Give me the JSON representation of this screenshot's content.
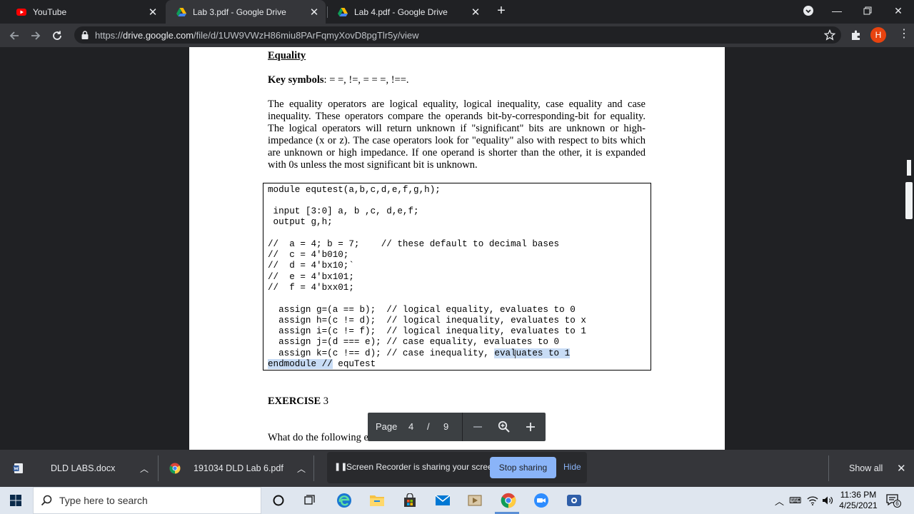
{
  "tabs": [
    {
      "title": "YouTube",
      "active": false,
      "icon": "youtube-icon"
    },
    {
      "title": "Lab 3.pdf - Google Drive",
      "active": true,
      "icon": "google-drive-icon"
    },
    {
      "title": "Lab 4.pdf - Google Drive",
      "active": false,
      "icon": "google-drive-icon"
    }
  ],
  "address": {
    "scheme": "https://",
    "host": "drive.google.com",
    "path": "/file/d/1UW9VWzH86miu8PArFqmyXovD8pgTlr5y/view"
  },
  "profile_initial": "H",
  "document": {
    "heading": "Equality",
    "key_symbols_label": "Key symbols",
    "key_symbols": ": = =, !=, = = =, !==.",
    "para_lines": [
      "The equality operators are logical equality, logical inequality, case equality and case",
      "inequality. These operators compare the operands bit-by-corresponding-bit for equality.",
      "The logical operators will return unknown if \"significant\" bits are unknown or high-",
      "impedance (x or z). The case operators look for \"equality\" also with respect to bits which",
      "are unknown or high impedance. If one operand is shorter than the other, it is expanded",
      "with 0s unless the most significant bit is unknown."
    ],
    "code_lines": [
      "module equtest(a,b,c,d,e,f,g,h);",
      "",
      " input [3:0] a, b ,c, d,e,f;",
      " output g,h;",
      "",
      "//  a = 4; b = 7;    // these default to decimal bases",
      "//  c = 4'b010;",
      "//  d = 4'bx10;`",
      "//  e = 4'bx101;",
      "//  f = 4'bxx01;",
      "",
      "  assign g=(a == b);  // logical equality, evaluates to 0",
      "  assign h=(c != d);  // logical inequality, evaluates to x",
      "  assign i=(c != f);  // logical inequality, evaluates to 1",
      "  assign j=(d === e); // case equality, evaluates to 0",
      "  assign k=(c !== d); // case inequality, ",
      ""
    ],
    "code_last_highlight": "evaluates to 1",
    "endmodule_highlight": "endmodule //",
    "endmodule_rest": " equTest",
    "exercise_bold": "EXERCISE",
    "exercise_num": " 3",
    "question": "What do the following evaluate to ?"
  },
  "page_toolbar": {
    "page_label": "Page",
    "current": "4",
    "slash": "/",
    "total": "9"
  },
  "downloads": [
    {
      "name": "DLD LABS.docx",
      "icon": "word-doc-icon"
    },
    {
      "name": "191034 DLD Lab 6.pdf",
      "icon": "chrome-icon"
    }
  ],
  "screen_share": {
    "message": "Screen Recorder is sharing your screen.",
    "stop_label": "Stop sharing",
    "hide_label": "Hide"
  },
  "show_all_label": "Show all",
  "taskbar": {
    "search_placeholder": "Type here to search",
    "time": "11:36 PM",
    "date": "4/25/2021",
    "notification_count": "6"
  },
  "colors": {
    "accent": "#8ab4f8",
    "selection": "#c8dcf5",
    "profile": "#e8430f"
  }
}
